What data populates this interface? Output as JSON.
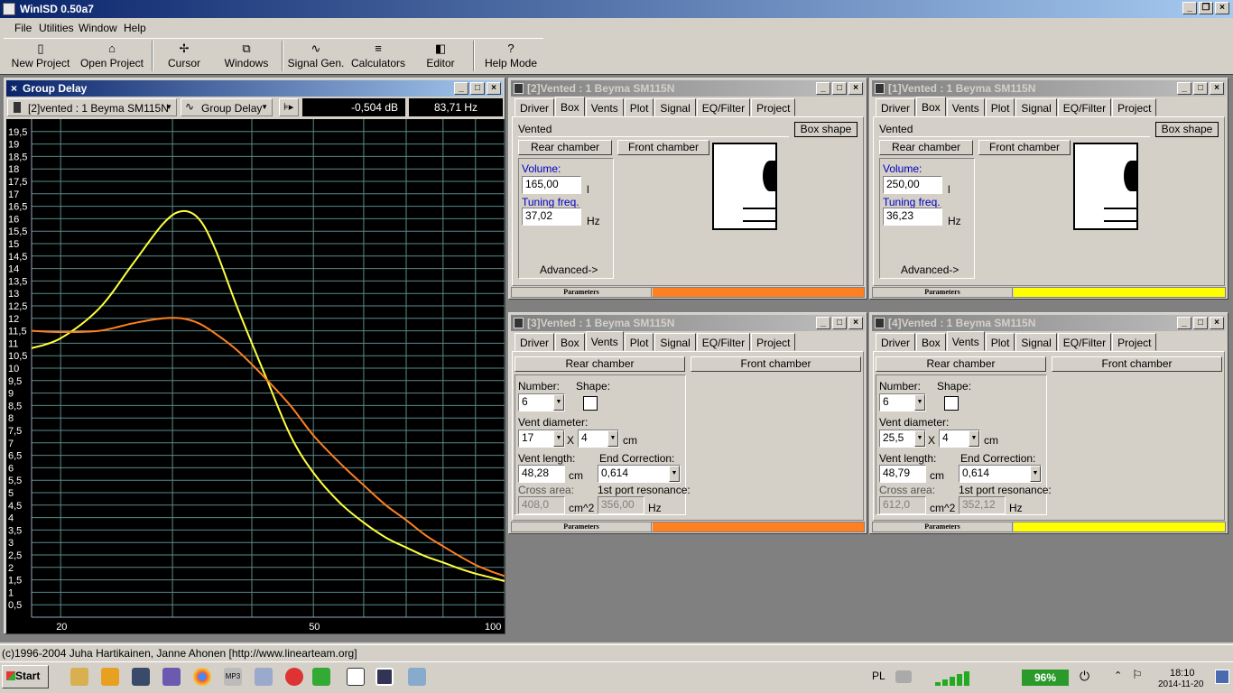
{
  "app": {
    "title": "WinISD 0.50a7"
  },
  "menu": [
    "File",
    "Utilities",
    "Window",
    "Help"
  ],
  "toolbar": {
    "new_project": "New Project",
    "open_project": "Open Project",
    "cursor": "Cursor",
    "windows": "Windows",
    "signal_gen": "Signal Gen.",
    "calculators": "Calculators",
    "editor": "Editor",
    "help_mode": "Help Mode"
  },
  "graph": {
    "title": "Group Delay",
    "project_select": "[2]vented : 1 Beyma SM115N",
    "type_select": "Group Delay",
    "readout_db": "-0,504 dB",
    "readout_hz": "83,71 Hz"
  },
  "chart_data": {
    "type": "line",
    "title": "Group Delay",
    "xlabel": "",
    "ylabel": "",
    "xscale": "log",
    "xlim": [
      18,
      100
    ],
    "ylim": [
      0,
      20
    ],
    "x_tick_labels": [
      "20",
      "50",
      "100"
    ],
    "y_tick_labels": [
      "0,5",
      "1",
      "1,5",
      "2",
      "2,5",
      "3",
      "3,5",
      "4",
      "4,5",
      "5",
      "5,5",
      "6",
      "6,5",
      "7",
      "7,5",
      "8",
      "8,5",
      "9",
      "9,5",
      "10",
      "10,5",
      "11",
      "11,5",
      "12",
      "12,5",
      "13",
      "13,5",
      "14",
      "14,5",
      "15",
      "15,5",
      "16",
      "16,5",
      "17",
      "17,5",
      "18",
      "18,5",
      "19",
      "19,5"
    ],
    "grid": true,
    "series": [
      {
        "color": "#ffff40",
        "x": [
          18,
          20,
          23,
          26,
          29,
          31,
          33,
          35,
          38,
          42,
          46,
          50,
          55,
          60,
          65,
          70,
          75,
          80,
          85,
          90,
          95,
          100
        ],
        "y": [
          10.8,
          11.2,
          12.4,
          14.2,
          15.8,
          16.3,
          16.0,
          14.8,
          12.4,
          9.7,
          7.3,
          5.8,
          4.6,
          3.8,
          3.2,
          2.8,
          2.45,
          2.2,
          1.95,
          1.75,
          1.6,
          1.45
        ]
      },
      {
        "color": "#ff8020",
        "x": [
          18,
          20,
          23,
          26,
          29,
          31,
          33,
          35,
          38,
          42,
          46,
          50,
          55,
          60,
          65,
          70,
          75,
          80,
          85,
          90,
          95,
          100
        ],
        "y": [
          11.5,
          11.45,
          11.5,
          11.8,
          12.0,
          12.0,
          11.8,
          11.4,
          10.7,
          9.6,
          8.5,
          7.3,
          6.2,
          5.3,
          4.5,
          3.9,
          3.3,
          2.85,
          2.45,
          2.1,
          1.85,
          1.65
        ]
      }
    ]
  },
  "windows": [
    {
      "title": "[2]Vented : 1 Beyma SM115N",
      "tabs": [
        "Driver",
        "Box",
        "Vents",
        "Plot",
        "Signal",
        "EQ/Filter",
        "Project"
      ],
      "active_tab": "Box",
      "box_type": "Vented",
      "box_shape": "Box shape",
      "rear": "Rear chamber",
      "front": "Front chamber",
      "volume_label": "Volume:",
      "volume": "165,00",
      "volume_unit": "l",
      "tuning_label": "Tuning freq.",
      "tuning": "37,02",
      "tuning_unit": "Hz",
      "advanced": "Advanced->",
      "params": "Parameters",
      "color": "#ff8020"
    },
    {
      "title": "[1]Vented : 1 Beyma SM115N",
      "tabs": [
        "Driver",
        "Box",
        "Vents",
        "Plot",
        "Signal",
        "EQ/Filter",
        "Project"
      ],
      "active_tab": "Box",
      "box_type": "Vented",
      "box_shape": "Box shape",
      "rear": "Rear chamber",
      "front": "Front chamber",
      "volume_label": "Volume:",
      "volume": "250,00",
      "volume_unit": "l",
      "tuning_label": "Tuning freq.",
      "tuning": "36,23",
      "tuning_unit": "Hz",
      "advanced": "Advanced->",
      "params": "Parameters",
      "color": "#ffff00"
    },
    {
      "title": "[3]Vented : 1 Beyma SM115N",
      "tabs": [
        "Driver",
        "Box",
        "Vents",
        "Plot",
        "Signal",
        "EQ/Filter",
        "Project"
      ],
      "active_tab": "Vents",
      "rear": "Rear chamber",
      "front": "Front chamber",
      "number_label": "Number:",
      "number": "6",
      "shape_label": "Shape:",
      "diam_label": "Vent diameter:",
      "diam": "17",
      "x": "X",
      "diam2": "4",
      "diam_unit": "cm",
      "length_label": "Vent length:",
      "length": "48,28",
      "length_unit": "cm",
      "endcorr_label": "End Correction:",
      "endcorr": "0,614",
      "cross_label": "Cross area:",
      "cross": "408,0",
      "cross_unit": "cm^2",
      "res_label": "1st port resonance:",
      "res": "356,00",
      "res_unit": "Hz",
      "params": "Parameters",
      "color": "#ff8020"
    },
    {
      "title": "[4]Vented : 1 Beyma SM115N",
      "tabs": [
        "Driver",
        "Box",
        "Vents",
        "Plot",
        "Signal",
        "EQ/Filter",
        "Project"
      ],
      "active_tab": "Vents",
      "rear": "Rear chamber",
      "front": "Front chamber",
      "number_label": "Number:",
      "number": "6",
      "shape_label": "Shape:",
      "diam_label": "Vent diameter:",
      "diam": "25,5",
      "x": "X",
      "diam2": "4",
      "diam_unit": "cm",
      "length_label": "Vent length:",
      "length": "48,79",
      "length_unit": "cm",
      "endcorr_label": "End Correction:",
      "endcorr": "0,614",
      "cross_label": "Cross area:",
      "cross": "612,0",
      "cross_unit": "cm^2",
      "res_label": "1st port resonance:",
      "res": "352,12",
      "res_unit": "Hz",
      "params": "Parameters",
      "color": "#ffff00"
    }
  ],
  "status": "(c)1996-2004 Juha Hartikainen, Janne Ahonen [http://www.linearteam.org]",
  "taskbar": {
    "start": "Start",
    "lang": "PL",
    "battery": "96%",
    "time": "18:10",
    "date": "2014-11-20"
  }
}
